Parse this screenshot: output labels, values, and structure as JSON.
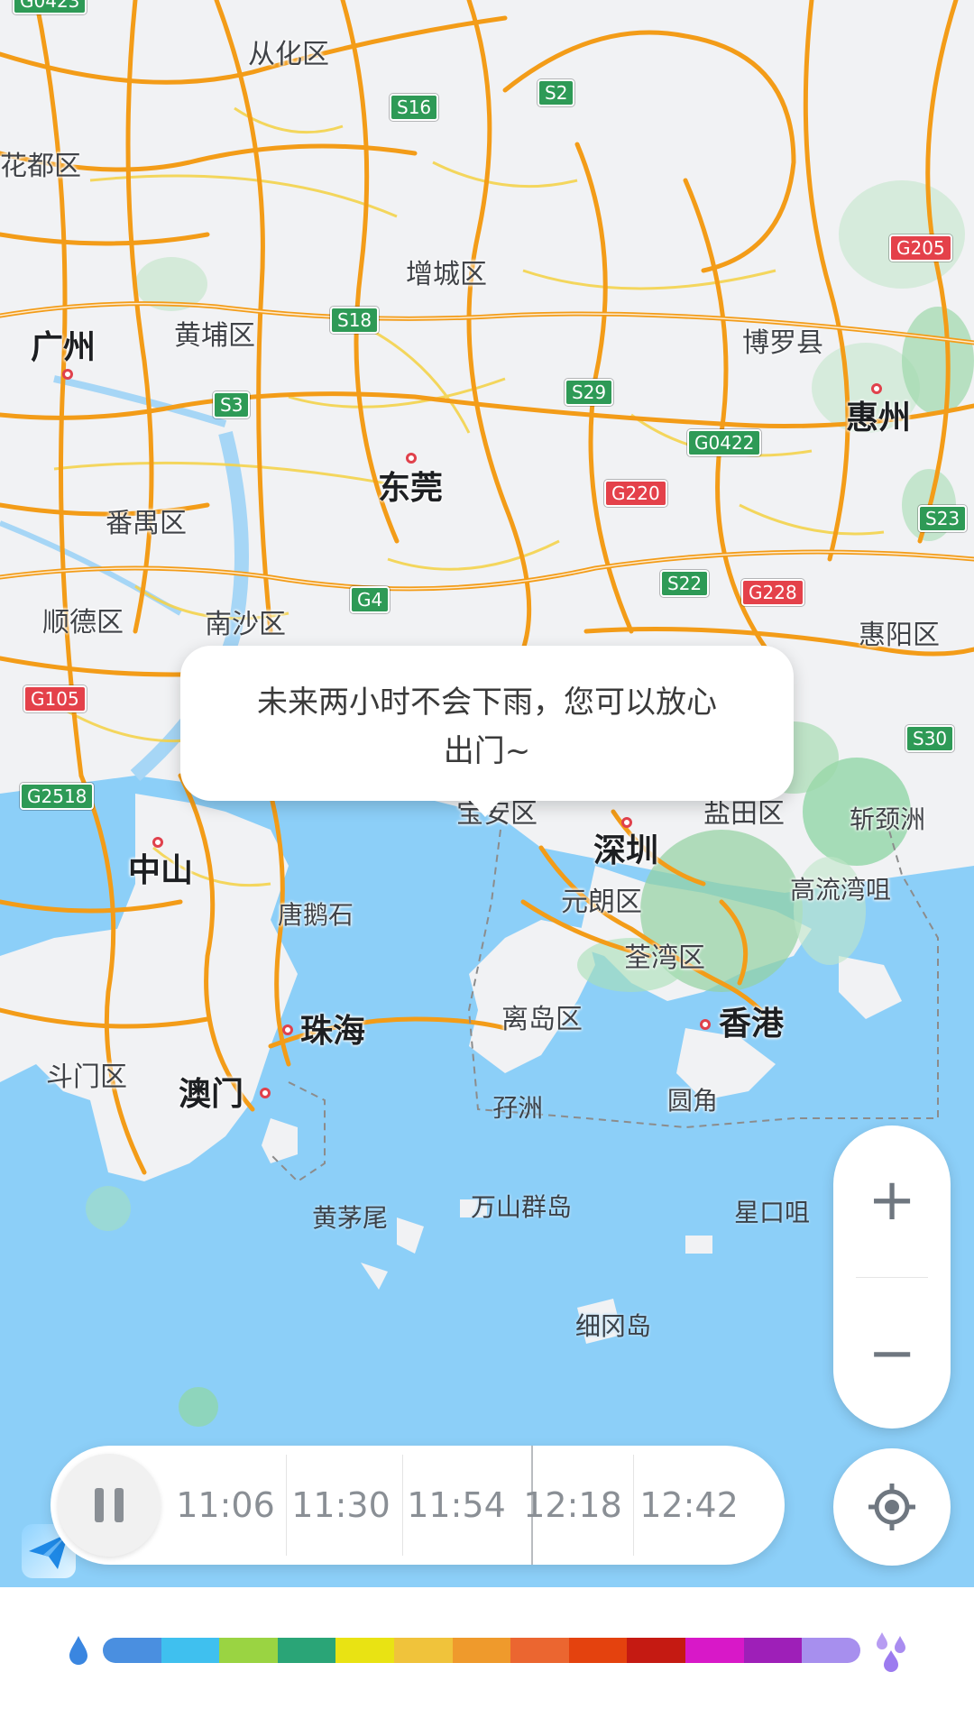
{
  "map": {
    "places": [
      {
        "name": "从化区",
        "type": "district"
      },
      {
        "name": "花都区",
        "type": "district"
      },
      {
        "name": "增城区",
        "type": "district"
      },
      {
        "name": "广州",
        "type": "city"
      },
      {
        "name": "黄埔区",
        "type": "district"
      },
      {
        "name": "博罗县",
        "type": "district"
      },
      {
        "name": "惠州",
        "type": "city"
      },
      {
        "name": "东莞",
        "type": "city"
      },
      {
        "name": "番禺区",
        "type": "district"
      },
      {
        "name": "顺德区",
        "type": "district"
      },
      {
        "name": "南沙区",
        "type": "district"
      },
      {
        "name": "惠阳区",
        "type": "district"
      },
      {
        "name": "宝安区",
        "type": "district"
      },
      {
        "name": "盐田区",
        "type": "district"
      },
      {
        "name": "深圳",
        "type": "city"
      },
      {
        "name": "中山",
        "type": "city"
      },
      {
        "name": "元朗区",
        "type": "district"
      },
      {
        "name": "高流湾咀",
        "type": "place"
      },
      {
        "name": "唐鹅石",
        "type": "place"
      },
      {
        "name": "荃湾区",
        "type": "district"
      },
      {
        "name": "珠海",
        "type": "city"
      },
      {
        "name": "离岛区",
        "type": "district"
      },
      {
        "name": "香港",
        "type": "city"
      },
      {
        "name": "斗门区",
        "type": "district"
      },
      {
        "name": "澳门",
        "type": "city"
      },
      {
        "name": "孖洲",
        "type": "island"
      },
      {
        "name": "圆角",
        "type": "place"
      },
      {
        "name": "黄茅尾",
        "type": "island"
      },
      {
        "name": "万山群岛",
        "type": "island"
      },
      {
        "name": "星口咀",
        "type": "island"
      },
      {
        "name": "细冈岛",
        "type": "island"
      },
      {
        "name": "斩颈洲",
        "type": "island"
      }
    ],
    "road_shields": [
      {
        "code": "G0423",
        "color": "green"
      },
      {
        "code": "S16",
        "color": "green"
      },
      {
        "code": "S2",
        "color": "green"
      },
      {
        "code": "G205",
        "color": "red"
      },
      {
        "code": "S18",
        "color": "green"
      },
      {
        "code": "S29",
        "color": "green"
      },
      {
        "code": "S3",
        "color": "green"
      },
      {
        "code": "G0422",
        "color": "green"
      },
      {
        "code": "G220",
        "color": "red"
      },
      {
        "code": "S23",
        "color": "green"
      },
      {
        "code": "S22",
        "color": "green"
      },
      {
        "code": "G228",
        "color": "red"
      },
      {
        "code": "G4",
        "color": "green"
      },
      {
        "code": "G105",
        "color": "red"
      },
      {
        "code": "S30",
        "color": "green"
      },
      {
        "code": "G2518",
        "color": "green"
      }
    ]
  },
  "tooltip": {
    "line1": "未来两小时不会下雨，您可以放心",
    "line2": "出门~"
  },
  "zoom": {
    "in_label": "+",
    "out_label": "−"
  },
  "timeline": {
    "times": [
      "11:06",
      "11:30",
      "11:54",
      "12:18",
      "12:42"
    ],
    "state": "playing"
  },
  "legend": {
    "colors": [
      "#4a8fe0",
      "#3fc0ef",
      "#9ad442",
      "#2aa577",
      "#e9e313",
      "#f0c33b",
      "#ef9a2c",
      "#eb6630",
      "#e4420e",
      "#c51a12",
      "#d818c8",
      "#9e1fb8",
      "#a78fee"
    ],
    "low_icon": "rain-drop-icon",
    "high_icon": "heavy-rain-icon"
  }
}
